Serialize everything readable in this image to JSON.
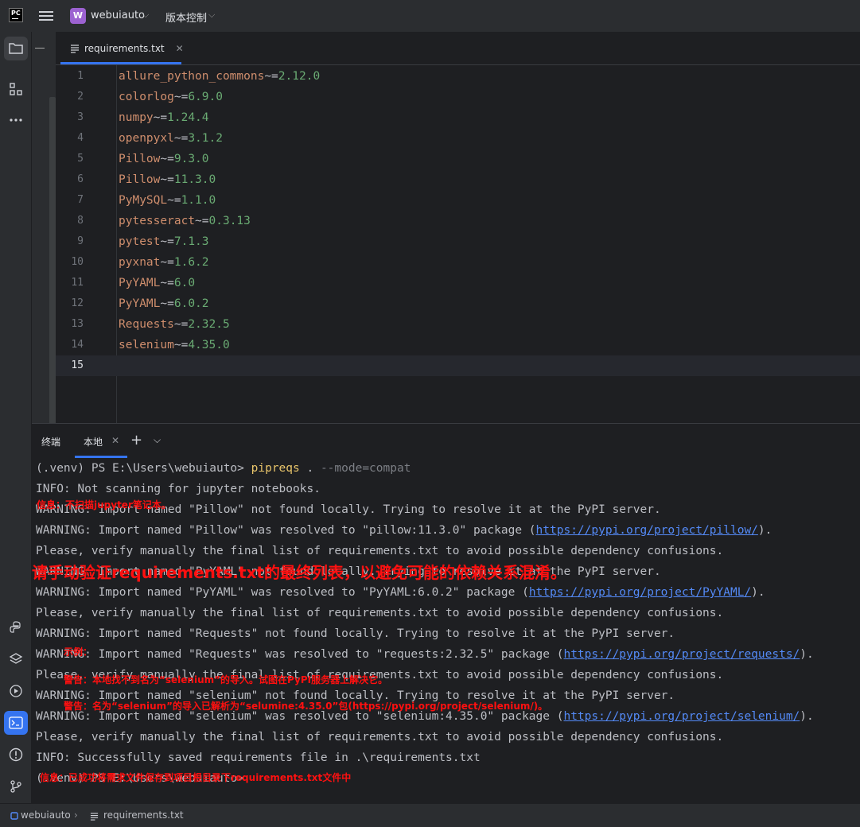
{
  "titlebar": {
    "logo": "PC",
    "project_badge": "W",
    "project_name": "webuiauto",
    "vcs_menu": "版本控制"
  },
  "editor_tab": {
    "label": "requirements.txt"
  },
  "editor": {
    "lines": [
      {
        "num": "1",
        "pkg": "allure_python_commons",
        "op": "~=",
        "ver": "2.12.0"
      },
      {
        "num": "2",
        "pkg": "colorlog",
        "op": "~=",
        "ver": "6.9.0"
      },
      {
        "num": "3",
        "pkg": "numpy",
        "op": "~=",
        "ver": "1.24.4"
      },
      {
        "num": "4",
        "pkg": "openpyxl",
        "op": "~=",
        "ver": "3.1.2"
      },
      {
        "num": "5",
        "pkg": "Pillow",
        "op": "~=",
        "ver": "9.3.0"
      },
      {
        "num": "6",
        "pkg": "Pillow",
        "op": "~=",
        "ver": "11.3.0"
      },
      {
        "num": "7",
        "pkg": "PyMySQL",
        "op": "~=",
        "ver": "1.1.0"
      },
      {
        "num": "8",
        "pkg": "pytesseract",
        "op": "~=",
        "ver": "0.3.13"
      },
      {
        "num": "9",
        "pkg": "pytest",
        "op": "~=",
        "ver": "7.1.3"
      },
      {
        "num": "10",
        "pkg": "pyxnat",
        "op": "~=",
        "ver": "1.6.2"
      },
      {
        "num": "11",
        "pkg": "PyYAML",
        "op": "~=",
        "ver": "6.0"
      },
      {
        "num": "12",
        "pkg": "PyYAML",
        "op": "~=",
        "ver": "6.0.2"
      },
      {
        "num": "13",
        "pkg": "Requests",
        "op": "~=",
        "ver": "2.32.5"
      },
      {
        "num": "14",
        "pkg": "selenium",
        "op": "~=",
        "ver": "4.35.0"
      },
      {
        "num": "15",
        "pkg": "",
        "op": "",
        "ver": ""
      }
    ]
  },
  "terminal": {
    "title": "终端",
    "tab_label": "本地",
    "prompt": "(.venv) PS E:\\Users\\webuiauto> ",
    "command": "pipreqs",
    "command_args_plain": " . ",
    "command_args_dim": "--mode=compat",
    "lines": {
      "l1": "INFO: Not scanning for jupyter notebooks.",
      "l2": "WARNING: Import named \"Pillow\" not found locally. Trying to resolve it at the PyPI server.",
      "l3_pre": "WARNING: Import named \"Pillow\" was resolved to \"pillow:11.3.0\" package (",
      "l3_link": "https://pypi.org/project/pillow/",
      "l3_post": ").",
      "l4": "Please, verify manually the final list of requirements.txt to avoid possible dependency confusions.",
      "l5": "WARNING: Import named \"PyYAML\" not found locally. Trying to resolve it at the PyPI server.",
      "l6_pre": "WARNING: Import named \"PyYAML\" was resolved to \"PyYAML:6.0.2\" package (",
      "l6_link": "https://pypi.org/project/PyYAML/",
      "l6_post": ").",
      "l7": "Please, verify manually the final list of requirements.txt to avoid possible dependency confusions.",
      "l8": "WARNING: Import named \"Requests\" not found locally. Trying to resolve it at the PyPI server.",
      "l9_pre": "WARNING: Import named \"Requests\" was resolved to \"requests:2.32.5\" package (",
      "l9_link": "https://pypi.org/project/requests/",
      "l9_post": ").",
      "l10": "Please, verify manually the final list of requirements.txt to avoid possible dependency confusions.",
      "l11": "WARNING: Import named \"selenium\" not found locally. Trying to resolve it at the PyPI server.",
      "l12_pre": "WARNING: Import named \"selenium\" was resolved to \"selenium:4.35.0\" package (",
      "l12_link": "https://pypi.org/project/selenium/",
      "l12_post": ").",
      "l13": "Please, verify manually the final list of requirements.txt to avoid possible dependency confusions.",
      "l14": "INFO: Successfully saved requirements file in .\\requirements.txt",
      "l15": "(.venv) PS E:\\Users\\webuiauto> "
    }
  },
  "annotations": {
    "a1": "信息：不扫描jupyter笔记本。",
    "a2": "请手动验证requirements.txt的最终列表，以避免可能的依赖关系混淆。",
    "a3": "示例：",
    "a4": "警告：本地找不到名为“selenium”的导入。试图在PyPI服务器上解决它。",
    "a5": "警告：名为“selenium”的导入已解析为“selumine:4.35.0”包(https://pypi.org/project/selenium/)。",
    "a6": "信息：已成功将需求文件保存到项目根目录下requirements.txt文件中"
  },
  "statusbar": {
    "project": "webuiauto",
    "file": "requirements.txt"
  },
  "colors": {
    "accent": "#3574f0",
    "annotation": "#ff1010",
    "package": "#cf8e6d",
    "version": "#6aab73",
    "command": "#e8c46a",
    "link": "#548af7"
  }
}
